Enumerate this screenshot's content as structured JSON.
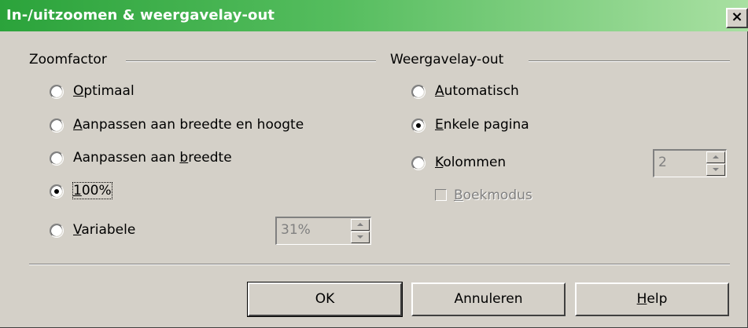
{
  "window": {
    "title": "In-/uitzoomen & weergavelay-out",
    "close_glyph": "×"
  },
  "zoom_group": {
    "label": "Zoomfactor",
    "options": [
      {
        "accel": "O",
        "rest": "ptimaal",
        "pre": "",
        "checked": false
      },
      {
        "accel": "A",
        "rest": "anpassen aan breedte en hoogte",
        "pre": "",
        "checked": false
      },
      {
        "pre": "Aanpassen aan ",
        "accel": "b",
        "rest": "reedte",
        "checked": false
      },
      {
        "accel": "1",
        "rest": "00%",
        "pre": "",
        "checked": true
      },
      {
        "accel": "V",
        "rest": "ariabele",
        "pre": "",
        "checked": false
      }
    ],
    "variable_value": "31%"
  },
  "layout_group": {
    "label": "Weergavelay-out",
    "options": [
      {
        "accel": "A",
        "rest": "utomatisch",
        "checked": false
      },
      {
        "accel": "E",
        "rest": "nkele pagina",
        "checked": true
      },
      {
        "accel": "K",
        "rest": "olommen",
        "checked": false
      }
    ],
    "columns_value": "2",
    "book_mode": {
      "accel": "B",
      "rest": "oekmodus",
      "checked": false,
      "disabled": true
    }
  },
  "buttons": {
    "ok": "OK",
    "cancel": "Annuleren",
    "help_accel": "H",
    "help_rest": "elp"
  }
}
